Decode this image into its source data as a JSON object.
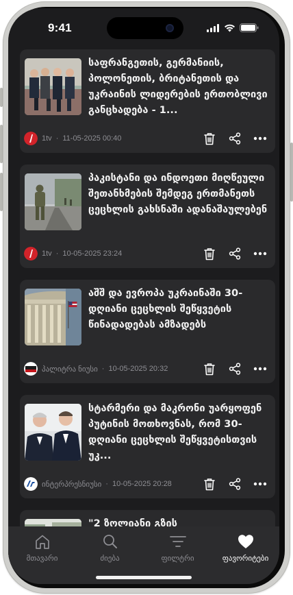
{
  "status_bar": {
    "time": "9:41"
  },
  "articles": [
    {
      "title": "საფრანგეთის, გერმანიის, პოლონეთის, ბრიტანეთის და უკრაინის ლიდერების ერთობლივი განცხადება - 1...",
      "source": "1tv",
      "timestamp": "11-05-2025 00:40",
      "logo_color": "#d2232a"
    },
    {
      "title": "პაკისტანი და ინდოეთი მიღწეული შეთანხმების შემდეგ ერთმანეთს ცეცხლის გახსნაში ადანაშაულებენ",
      "source": "1tv",
      "timestamp": "10-05-2025 23:24",
      "logo_color": "#d2232a"
    },
    {
      "title": "აშშ და ევროპა უკრაინაში 30-დღიანი ცეცხლის შეწყვეტის წინადადებას ამზადებს",
      "source": "პალიტრა ნიუსი",
      "timestamp": "10-05-2025 20:32",
      "logo_color": "#c4161c"
    },
    {
      "title": "სტარმერი და მაკრონი უარყოფენ პუტინის მოთხოვნას, რომ 30-დღიანი ცეცხლის შეწყვეტისთვის უკ...",
      "source": "ინტერპრესნიუსი",
      "timestamp": "10-05-2025 20:28",
      "logo_color": "#1a4fa0"
    },
    {
      "title": "\"2 ზოლიანი გზის",
      "source": "",
      "timestamp": "",
      "logo_color": "#666666"
    }
  ],
  "tabs": [
    {
      "label": "მთავარი",
      "icon": "home-icon"
    },
    {
      "label": "ძიება",
      "icon": "search-icon"
    },
    {
      "label": "ფილტრი",
      "icon": "filter-icon"
    },
    {
      "label": "ფავორიტები",
      "icon": "heart-icon"
    }
  ],
  "colors": {
    "background": "#1c1c1e",
    "card": "#2a2a2c",
    "tab_bar": "#2c2c2e",
    "text_primary": "#f2f2f2",
    "text_secondary": "#8e8e93",
    "tab_active": "#ffffff"
  }
}
